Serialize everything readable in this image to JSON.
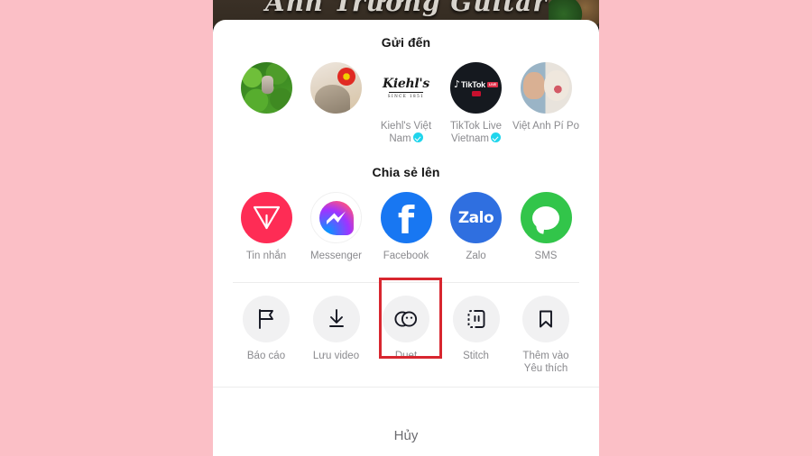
{
  "video": {
    "title": "Anh Trường Guitar"
  },
  "sheet": {
    "send_to": {
      "heading": "Gửi đến",
      "contacts": [
        {
          "name": "",
          "avatar": "leaf-cat-avatar",
          "verified": false
        },
        {
          "name": "",
          "avatar": "cat-flower-avatar",
          "verified": false
        },
        {
          "name": "Kiehl's Việt Nam",
          "avatar": "kiehls-logo",
          "verified": true,
          "logo_word": "Kiehl's",
          "logo_since": "SINCE 1851"
        },
        {
          "name": "TikTok Live Vietnam",
          "avatar": "tiktok-logo",
          "verified": true,
          "logo_word": "TikTok",
          "logo_live": "LIVE"
        },
        {
          "name": "Việt Anh Pí Po",
          "avatar": "person-dog-avatar",
          "verified": false
        }
      ]
    },
    "share_to": {
      "heading": "Chia sẻ lên",
      "apps": [
        {
          "label": "Tin nhắn",
          "icon": "tiktok-direct-message-icon",
          "color": "#fe2c55"
        },
        {
          "label": "Messenger",
          "icon": "messenger-icon",
          "color": "#a033ff"
        },
        {
          "label": "Facebook",
          "icon": "facebook-icon",
          "color": "#1877f2",
          "glyph": "f"
        },
        {
          "label": "Zalo",
          "icon": "zalo-icon",
          "color": "#2f6fe0",
          "glyph": "Zalo"
        },
        {
          "label": "SMS",
          "icon": "sms-icon",
          "color": "#32c54a"
        }
      ]
    },
    "actions": [
      {
        "label": "Báo cáo",
        "icon": "flag-icon"
      },
      {
        "label": "Lưu video",
        "icon": "download-icon"
      },
      {
        "label": "Duet",
        "icon": "duet-icon",
        "highlighted": true
      },
      {
        "label": "Stitch",
        "icon": "stitch-icon"
      },
      {
        "label": "Thêm vào Yêu thích",
        "icon": "bookmark-icon"
      }
    ],
    "cancel_label": "Hủy"
  },
  "colors": {
    "page_background": "#fbbfc6",
    "sheet_background": "#ffffff",
    "highlight_border": "#d8262f",
    "label_text": "#8a8a8e",
    "verified_badge": "#20d5ec"
  }
}
